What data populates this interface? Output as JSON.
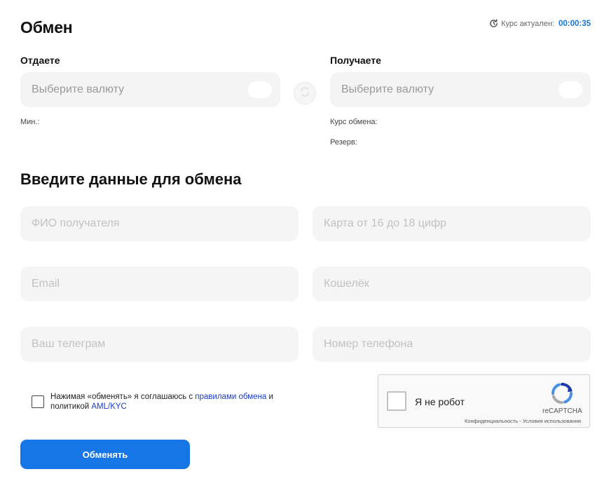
{
  "header": {
    "title": "Обмен",
    "rate_label": "Курс актуален:",
    "rate_timer": "00:00:35",
    "rate_icon": "clock-refresh-icon"
  },
  "give": {
    "label": "Отдаете",
    "placeholder": "Выберите валюту",
    "min_label": "Мин.:"
  },
  "get": {
    "label": "Получаете",
    "placeholder": "Выберите валюту",
    "rate_label": "Курс обмена:",
    "reserve_label": "Резерв:"
  },
  "swap": {
    "icon": "swap-icon"
  },
  "form": {
    "title": "Введите данные для обмена",
    "fields": {
      "full_name": "ФИО получателя",
      "card": "Карта от 16 до 18 цифр",
      "email": "Email",
      "wallet": "Кошелёк",
      "telegram": "Ваш телеграм",
      "phone": "Номер телефона"
    }
  },
  "agreement": {
    "text_before": "Нажимая «обменять» я соглашаюсь с ",
    "rules_link": "правилами обмена",
    "text_middle": " и политикой ",
    "aml_link": "AML/KYC"
  },
  "recaptcha": {
    "label": "Я не робот",
    "brand": "reCAPTCHA",
    "privacy": "Конфиденциальность",
    "separator": " - ",
    "terms": "Условия использования"
  },
  "submit": {
    "label": "Обменять"
  },
  "colors": {
    "accent": "#1676e6",
    "timer": "#1976d2",
    "link": "#1a3cc9",
    "field_bg": "#f5f5f5"
  }
}
